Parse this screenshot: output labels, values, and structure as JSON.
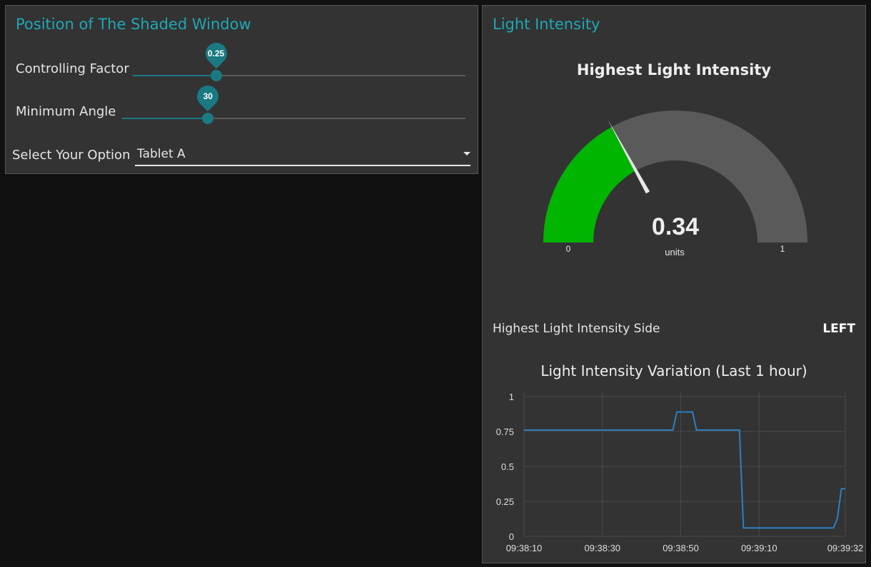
{
  "window_panel": {
    "title": "Position of The Shaded Window",
    "controlling_factor": {
      "label": "Controlling Factor",
      "value": 0.25,
      "display": "0.25",
      "fraction": 0.25
    },
    "minimum_angle": {
      "label": "Minimum Angle",
      "value": 30,
      "display": "30",
      "fraction": 0.25
    },
    "option": {
      "label": "Select Your Option",
      "value": "Tablet A"
    }
  },
  "light_panel": {
    "title": "Light Intensity",
    "gauge": {
      "title": "Highest Light Intensity",
      "value": 0.34,
      "value_display": "0.34",
      "units": "units",
      "min": 0,
      "max": 1,
      "min_label": "0",
      "max_label": "1",
      "fill_color": "#00b500",
      "track_color": "#5a5a5a"
    },
    "side": {
      "label": "Highest Light Intensity Side",
      "value": "LEFT"
    }
  },
  "chart_data": {
    "type": "line",
    "title": "Light Intensity Variation (Last 1 hour)",
    "xlabel": "",
    "ylabel": "",
    "ylim": [
      0,
      1
    ],
    "yticks": [
      "0",
      "0.25",
      "0.5",
      "0.75",
      "1"
    ],
    "xticks": [
      "09:38:10",
      "09:38:30",
      "09:38:50",
      "09:39:10",
      "09:39:32"
    ],
    "grid": true,
    "line_color": "#2d7fc1",
    "series": [
      {
        "x": [
          "09:38:10",
          "09:38:48",
          "09:38:49",
          "09:38:53",
          "09:38:54",
          "09:39:05",
          "09:39:06",
          "09:39:29",
          "09:39:30",
          "09:39:31",
          "09:39:32"
        ],
        "values": [
          0.76,
          0.76,
          0.89,
          0.89,
          0.76,
          0.76,
          0.06,
          0.06,
          0.13,
          0.34,
          0.34
        ]
      }
    ]
  }
}
